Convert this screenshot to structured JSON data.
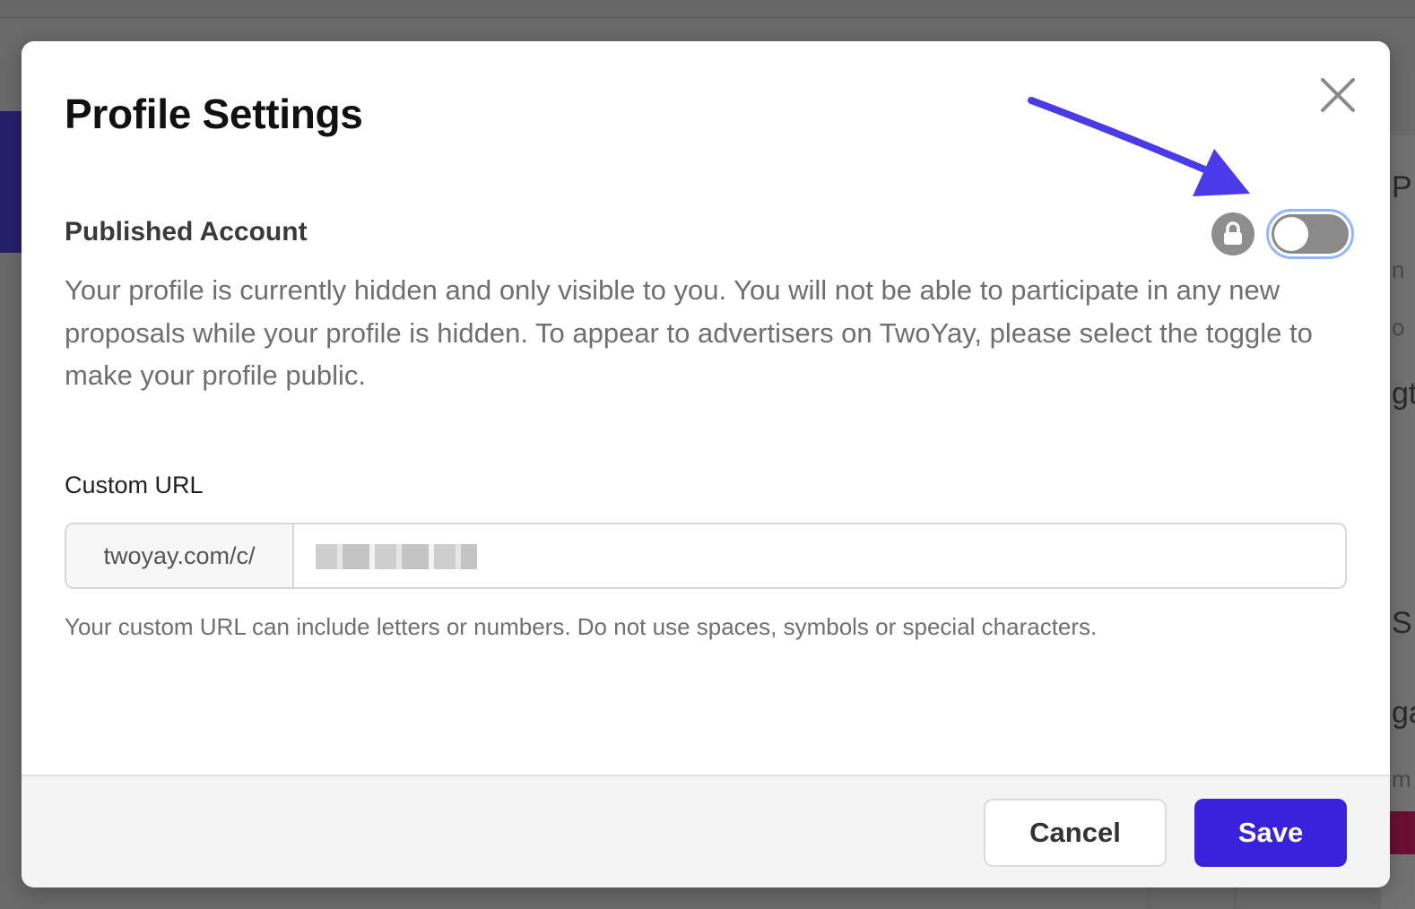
{
  "modal": {
    "title": "Profile Settings",
    "close_icon": "close-icon"
  },
  "published_account": {
    "label": "Published Account",
    "lock_icon": "lock-icon",
    "toggle_on": false,
    "description": "Your profile is currently hidden and only visible to you. You will not be able to participate in any new proposals while your profile is hidden. To appear to advertisers on TwoYay, please select the toggle to make your profile public."
  },
  "custom_url": {
    "label": "Custom URL",
    "prefix": "twoyay.com/c/",
    "value": "",
    "help": "Your custom URL can include letters or numbers. Do not use spaces, symbols or special characters."
  },
  "footer": {
    "cancel_label": "Cancel",
    "save_label": "Save"
  },
  "colors": {
    "primary": "#3a22dc",
    "toggle_off": "#8a8a8a",
    "annotation_arrow": "#4b3ae8"
  },
  "background": {
    "fragments": [
      "P",
      "n",
      "o",
      "gt",
      "S",
      "ga",
      "m"
    ]
  }
}
